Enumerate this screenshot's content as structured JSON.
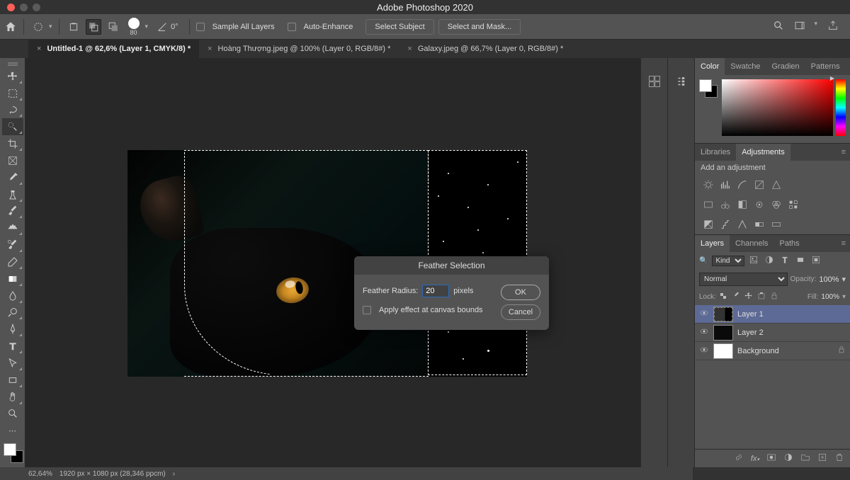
{
  "app_title": "Adobe Photoshop 2020",
  "options_bar": {
    "brush_size": "80",
    "angle": "0°",
    "sample_all_layers": "Sample All Layers",
    "auto_enhance": "Auto-Enhance",
    "select_subject": "Select Subject",
    "select_and_mask": "Select and Mask..."
  },
  "tabs": [
    {
      "label": "Untitled-1 @ 62,6% (Layer 1, CMYK/8) *",
      "active": true
    },
    {
      "label": "Hoàng Thượng.jpeg @ 100% (Layer 0, RGB/8#) *",
      "active": false
    },
    {
      "label": "Galaxy.jpeg @ 66,7% (Layer 0, RGB/8#) *",
      "active": false
    }
  ],
  "dialog": {
    "title": "Feather Selection",
    "radius_label": "Feather Radius:",
    "radius_value": "20",
    "radius_unit": "pixels",
    "apply_bounds": "Apply effect at canvas bounds",
    "ok": "OK",
    "cancel": "Cancel"
  },
  "panels": {
    "color": "Color",
    "swatches": "Swatche",
    "gradients": "Gradien",
    "patterns": "Patterns",
    "libraries": "Libraries",
    "adjustments": "Adjustments",
    "add_adjustment": "Add an adjustment",
    "layers_tab": "Layers",
    "channels_tab": "Channels",
    "paths_tab": "Paths",
    "kind_label": "Kind",
    "blend_mode": "Normal",
    "opacity_label": "Opacity:",
    "opacity_value": "100%",
    "lock_label": "Lock:",
    "fill_label": "Fill:",
    "fill_value": "100%",
    "layers": [
      {
        "name": "Layer 1"
      },
      {
        "name": "Layer 2"
      },
      {
        "name": "Background"
      }
    ]
  },
  "status": {
    "zoom": "62,64%",
    "info": "1920 px × 1080 px (28,346 ppcm)",
    "arrow": "›"
  },
  "tools": [
    "move",
    "marquee",
    "lasso",
    "quick-select",
    "crop",
    "frame",
    "eyedropper",
    "healing",
    "brush",
    "stamp",
    "history-brush",
    "eraser",
    "gradient",
    "blur",
    "dodge",
    "pen",
    "type",
    "path-select",
    "rectangle",
    "hand",
    "zoom",
    "edit-toolbar"
  ]
}
